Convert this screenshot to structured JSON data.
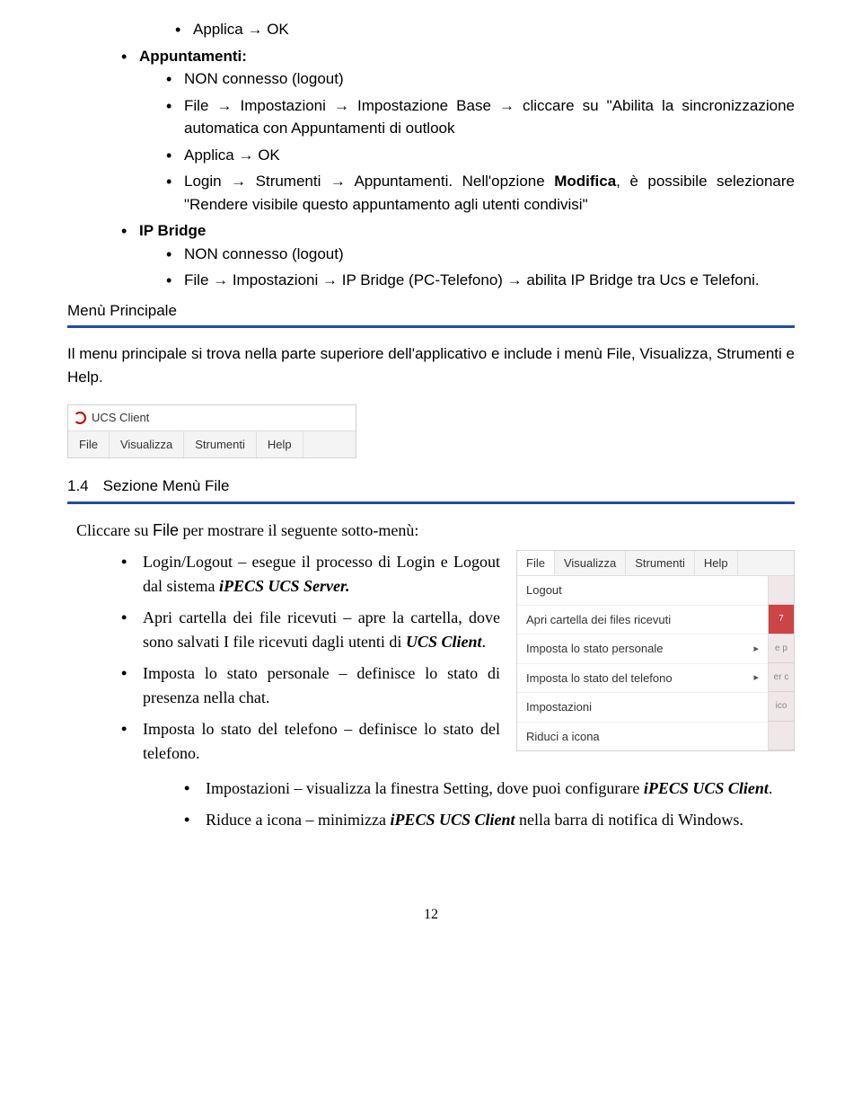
{
  "arrow": " → ",
  "top": {
    "applica_ok": "Applica → OK",
    "appuntamenti": "Appuntamenti:",
    "a_items": {
      "non_connesso": "NON connesso (logout)",
      "file_imp": "File → Impostazioni → Impostazione Base → cliccare su \"Abilita la sincronizzazione automatica con Appuntamenti di outlook",
      "applica_ok2": "Applica → OK",
      "login_str": "Login → Strumenti → Appuntamenti. Nell'opzione ",
      "modifica": "Modifica",
      "login_str_tail": ", è possibile selezionare \"Rendere visibile questo appuntamento agli utenti condivisi\""
    },
    "ip_bridge": "IP Bridge",
    "ip_items": {
      "non_connesso": "NON connesso (logout)",
      "file_ip": "File → Impostazioni → IP Bridge (PC-Telefono) → abilita IP Bridge tra Ucs e Telefoni."
    }
  },
  "menu_principale": "Menù Principale",
  "mp_para": "Il menu principale si trova nella parte superiore dell'applicativo e include i menù File, Visualizza, Strumenti e Help.",
  "ucs1": {
    "title": "UCS Client",
    "items": [
      "File",
      "Visualizza",
      "Strumenti",
      "Help"
    ]
  },
  "sec14": {
    "num": "1.4",
    "title": "Sezione Menù File",
    "cliccare_pre": "Cliccare su ",
    "cliccare_mid": "File",
    "cliccare_post": " per mostrare il seguente sotto-menù:",
    "items": {
      "i1a": "Login/Logout – esegue il processo di Login e Logout dal sistema ",
      "i1b": "iPECS UCS Server.",
      "i2a": "Apri cartella dei file ricevuti – apre la cartella, dove sono salvati I file ricevuti dagli utenti di ",
      "i2b": "UCS Client",
      "i2c": ".",
      "i3": "Imposta lo stato personale – definisce lo stato di presenza nella chat.",
      "i4": "Imposta lo stato del telefono – definisce lo stato del telefono.",
      "i5a": "Impostazioni – visualizza la finestra Setting, dove puoi configurare ",
      "i5b": "iPECS UCS Client",
      "i5c": ".",
      "i6a": "Riduce a icona – minimizza ",
      "i6b": "iPECS UCS Client",
      "i6c": " nella barra di notifica di Windows."
    }
  },
  "dd": {
    "top": [
      "File",
      "Visualizza",
      "Strumenti",
      "Help"
    ],
    "items": [
      {
        "label": "Logout",
        "arrow": false
      },
      {
        "label": "Apri cartella dei files ricevuti",
        "arrow": false
      },
      {
        "label": "Imposta lo stato personale",
        "arrow": true
      },
      {
        "label": "Imposta lo stato del telefono",
        "arrow": true
      },
      {
        "label": "Impostazioni",
        "arrow": false
      },
      {
        "label": "Riduci a icona",
        "arrow": false
      }
    ],
    "side": [
      "",
      "7",
      "e p",
      "er c",
      "ico",
      ""
    ]
  },
  "pagenum": "12"
}
